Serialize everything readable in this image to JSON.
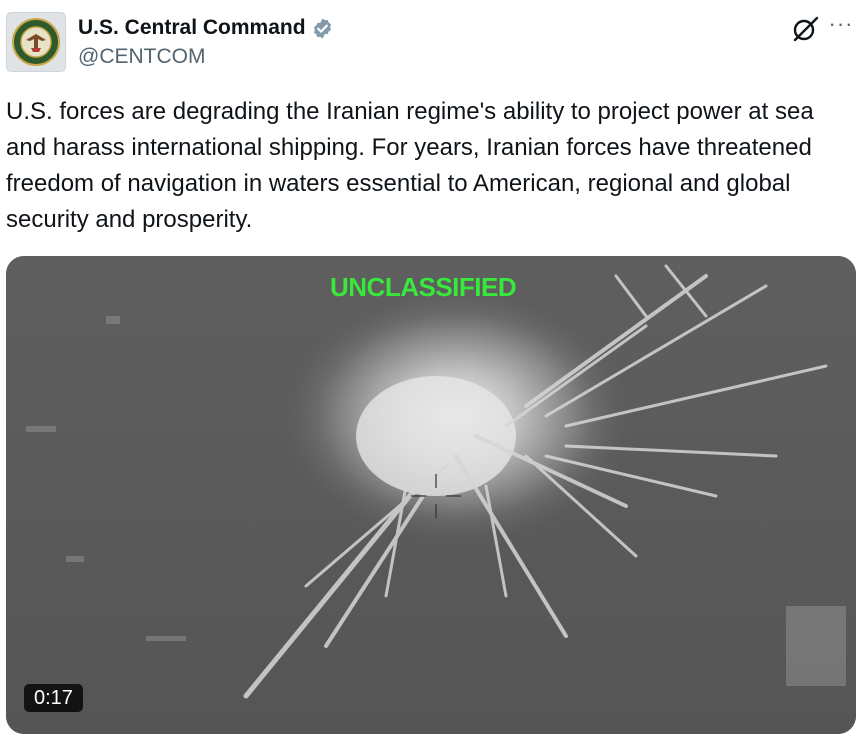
{
  "author": {
    "name": "U.S. Central Command",
    "handle": "@CENTCOM",
    "avatar_icon": "centcom-seal-icon",
    "verified_icon": "verified-badge-icon",
    "verified_color": "#829aab"
  },
  "actions": {
    "grok_icon": "grok-icon",
    "more_label": "···"
  },
  "tweet": {
    "text": "U.S. forces are degrading the Iranian regime's ability to project power at sea and harass international shipping. For years, Iranian forces have threatened freedom of navigation in waters essential to American, regional and global security and prosperity."
  },
  "media": {
    "overlay_label": "UNCLASSIFIED",
    "overlay_color": "#38e83a",
    "duration": "0:17"
  }
}
